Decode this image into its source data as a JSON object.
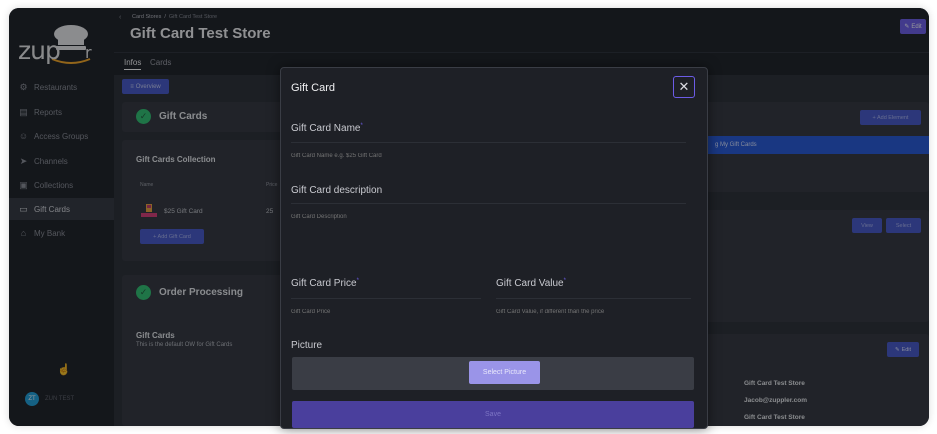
{
  "colors": {
    "accent": "#6c5ce7",
    "primary_button": "#4657c8",
    "success": "#2fbf71",
    "highlight": "#2557d6",
    "sidebar_bg": "#1d1f25",
    "content_bg": "#2a2d34"
  },
  "logo": {
    "text": "zup",
    "icon": "chef-hat-logo"
  },
  "sidebar": {
    "items": [
      {
        "label": "Restaurants",
        "icon": "fork-knife-icon"
      },
      {
        "label": "Reports",
        "icon": "report-icon"
      },
      {
        "label": "Access Groups",
        "icon": "users-icon"
      },
      {
        "label": "Channels",
        "icon": "rocket-icon"
      },
      {
        "label": "Collections",
        "icon": "collection-icon"
      },
      {
        "label": "Gift Cards",
        "icon": "credit-card-icon",
        "active": true
      },
      {
        "label": "My Bank",
        "icon": "bank-icon"
      }
    ],
    "bottom_icon": "hand-icon",
    "user": {
      "initials": "ZT",
      "name": "ZUN TEST"
    }
  },
  "header": {
    "breadcrumb": [
      "Card Stores",
      "Gift Card Test Store"
    ],
    "title": "Gift Card Test Store",
    "edit_label": "Edit"
  },
  "tabs": [
    {
      "label": "Infos",
      "active": true
    },
    {
      "label": "Cards",
      "active": false
    }
  ],
  "main": {
    "overview_label": "Overview",
    "gift_cards_title": "Gift Cards",
    "collection": {
      "title": "Gift Cards Collection",
      "col_name": "Name",
      "col_price": "Price",
      "rows": [
        {
          "name": "$25 Gift Card",
          "price": "25"
        }
      ],
      "add_label": "+ Add Gift Card"
    },
    "order_processing": {
      "title": "Order Processing",
      "sub_title": "Gift Cards",
      "sub_text": "This is the default OW for Gift Cards"
    },
    "right": {
      "add_label": "+ Add Element",
      "highlight_text": "g My Gift Cards",
      "btn_view": "View",
      "btn_select": "Select",
      "edit_label": "Edit",
      "store_name": "Gift Card Test Store",
      "store_email": "Jacob@zuppler.com",
      "store_extra": "Gift Card Test Store"
    }
  },
  "modal": {
    "title": "Gift Card",
    "fields": {
      "name": {
        "label": "Gift Card Name",
        "placeholder": "Gift Card Name e.g. $25 Gift Card"
      },
      "description": {
        "label": "Gift Card description",
        "placeholder": "Gift Card Description"
      },
      "price": {
        "label": "Gift Card Price",
        "placeholder": "Gift Card Price"
      },
      "value": {
        "label": "Gift Card Value",
        "placeholder": "Gift Card Value, if different than the price"
      }
    },
    "picture": {
      "label": "Picture",
      "button": "Select Picture"
    },
    "save_label": "Save"
  }
}
